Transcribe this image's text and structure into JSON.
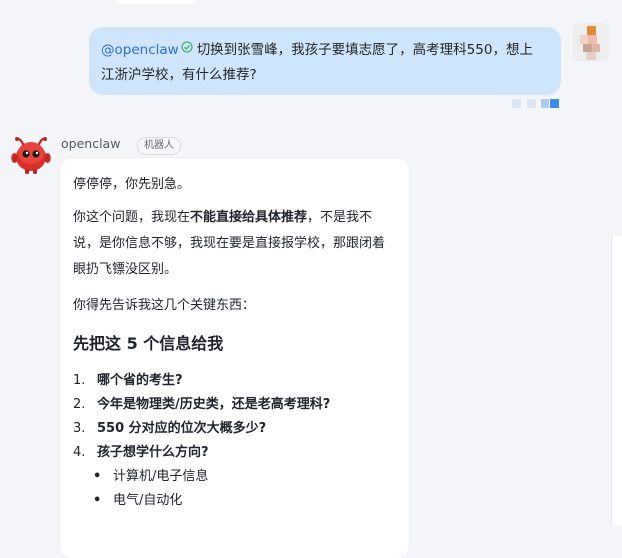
{
  "user_message": {
    "mention": "@openclaw",
    "line1": "切换到张雪峰，我孩子要填志愿了，高考理科550，想上",
    "line2": "江浙沪学校，有什么推荐?"
  },
  "bot": {
    "name": "openclaw",
    "badge": "机器人",
    "p1": "停停停，你先别急。",
    "p2_prefix": "你这个问题，我现在",
    "p2_bold": "不能直接给具体推荐",
    "p2_suffix": "，不是我不说，是你信息不够，我现在要是直接报学校，那跟闭着眼扔飞镖没区别。",
    "p3": "你得先告诉我这几个关键东西：",
    "heading": "先把这 5 个信息给我",
    "questions": [
      {
        "num": "1.",
        "text": "哪个省的考生?"
      },
      {
        "num": "2.",
        "text": "今年是物理类/历史类，还是老高考理科?"
      },
      {
        "num": "3.",
        "text": "550 分对应的位次大概多少?"
      },
      {
        "num": "4.",
        "text": "孩子想学什么方向?"
      }
    ],
    "directions": [
      "计算机/电子信息",
      "电气/自动化"
    ],
    "bullet": "•"
  },
  "icons": {
    "verified": "check-circle-icon",
    "bot_avatar": "red-robot-icon"
  },
  "colors": {
    "user_bubble": "#cfe5fb",
    "mention": "#2a6fd6",
    "verified": "#3cb371",
    "bot_avatar": "#d9302c"
  }
}
